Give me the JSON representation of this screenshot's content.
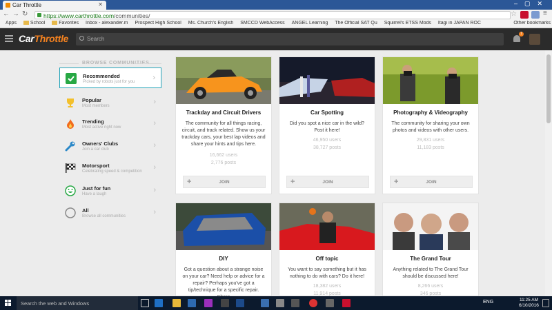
{
  "browser": {
    "tab_title": "Car Throttle",
    "url_host": "https://www.carthrottle.com",
    "url_path": "/communities/",
    "bookmarks": [
      "Apps",
      "School",
      "Favorites",
      "Inbox - alexander.m",
      "Prospect High School",
      "Ms. Church's English",
      "SMCCD WebAccess",
      "ANGEL Learning",
      "The Official SAT Qu",
      "Squirrel's ETSS Mods",
      "Itagi in JAPAN ROC",
      "Other bookmarks"
    ]
  },
  "header": {
    "logo_part1": "Car",
    "logo_part2": "Throttle",
    "search_placeholder": "Search",
    "notification_count": "1"
  },
  "sidebar": {
    "heading": "BROWSE COMMUNITIES",
    "items": [
      {
        "title": "Recommended",
        "subtitle": "Picked by robots just for you",
        "icon": "check-icon"
      },
      {
        "title": "Popular",
        "subtitle": "Most members",
        "icon": "trophy-icon"
      },
      {
        "title": "Trending",
        "subtitle": "Most active right now",
        "icon": "flame-icon"
      },
      {
        "title": "Owners' Clubs",
        "subtitle": "Join a car club",
        "icon": "wrench-icon"
      },
      {
        "title": "Motorsport",
        "subtitle": "Celebrating speed & competition",
        "icon": "checkered-flag-icon"
      },
      {
        "title": "Just for fun",
        "subtitle": "Have a laugh",
        "icon": "smiley-icon"
      },
      {
        "title": "All",
        "subtitle": "Browse all communities",
        "icon": "circle-icon"
      }
    ]
  },
  "communities": [
    {
      "title": "Trackday and Circuit Drivers",
      "description": "The community for all things racing, circuit, and track related. Show us your trackday cars, your best lap videos and share your hints and tips here.",
      "users": "16,662 users",
      "posts": "2,776 posts",
      "join": "JOIN"
    },
    {
      "title": "Car Spotting",
      "description": "Did you spot a nice car in the wild? Post it here!",
      "users": "46,950 users",
      "posts": "38,727 posts",
      "join": "JOIN"
    },
    {
      "title": "Photography & Videography",
      "description": "The community for sharing your own photos and videos with other users.",
      "users": "29,831 users",
      "posts": "11,183 posts",
      "join": "JOIN"
    },
    {
      "title": "DIY",
      "description": "Got a question about a strange noise on your car? Need help or advice for a repair? Perhaps you've got a tip/technique for a specific repair. Share",
      "users": "",
      "posts": "",
      "join": ""
    },
    {
      "title": "Off topic",
      "description": "You want to say something but it has nothing to do with cars? Do it here!",
      "users": "18,382 users",
      "posts": "11,914 posts",
      "join": ""
    },
    {
      "title": "The Grand Tour",
      "description": "Anything related to The Grand Tour should be discussed here!",
      "users": "8,266 users",
      "posts": "346 posts",
      "join": ""
    }
  ],
  "taskbar": {
    "search_text": "Search the web and Windows",
    "language": "ENG",
    "time": "11:25 AM",
    "date": "6/10/2016"
  }
}
